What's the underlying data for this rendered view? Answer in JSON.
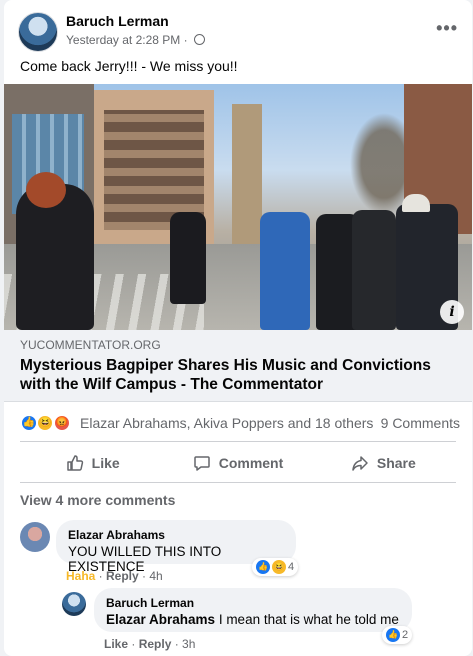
{
  "post": {
    "author": "Baruch Lerman",
    "timestamp": "Yesterday at 2:28 PM ·",
    "privacy_icon": "globe-icon",
    "more_label": "•••",
    "caption": "Come back Jerry!!! - We miss you!!"
  },
  "link": {
    "domain": "YUCOMMENTATOR.ORG",
    "title": "Mysterious Bagpiper Shares His Music and Convictions with the Wilf Campus - The Commentator",
    "info_label": "i"
  },
  "reactions": {
    "icons": [
      "like",
      "haha",
      "angry"
    ],
    "names": "Elazar Abrahams, Akiva Poppers and 18 others",
    "comment_count": "9 Comments"
  },
  "actions": {
    "like": "Like",
    "comment": "Comment",
    "share": "Share"
  },
  "comments": {
    "view_more": "View 4 more comments",
    "items": [
      {
        "name": "Elazar Abrahams",
        "text": "YOU WILLED THIS INTO EXISTENCE",
        "my_reaction": "Haha",
        "reply": "Reply",
        "time": "4h",
        "reaction_count": "4"
      },
      {
        "name": "Baruch Lerman",
        "mention": "Elazar Abrahams",
        "text": " I mean that is what he told me",
        "my_reaction": "Like",
        "reply": "Reply",
        "time": "3h",
        "reaction_count": "2"
      }
    ]
  },
  "colors": {
    "facebook_blue": "#1877f2",
    "haha_yellow": "#f7b928",
    "angry_red": "#e8564a",
    "secondary_text": "#65676b"
  }
}
